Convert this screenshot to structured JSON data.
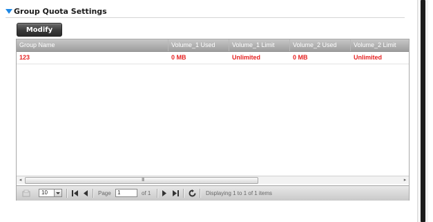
{
  "section": {
    "title": "Group Quota Settings"
  },
  "toolbar": {
    "modify_label": "Modify"
  },
  "grid": {
    "columns": [
      "Group Name",
      "Volume_1 Used",
      "Volume_1 Limit",
      "Volume_2 Used",
      "Volume_2 Limit"
    ],
    "rows": [
      {
        "group_name": "123",
        "v1_used": "0 MB",
        "v1_limit": "Unlimited",
        "v2_used": "0 MB",
        "v2_limit": "Unlimited"
      }
    ],
    "row_text_color": "#e52222"
  },
  "hscroll": {
    "left_arrow": "◂",
    "right_arrow": "▸",
    "grip": "III"
  },
  "pager": {
    "page_size": "10",
    "page_label": "Page",
    "page_value": "1",
    "of_label": "of 1",
    "status": "Displaying 1 to 1 of 1 items",
    "icons": [
      "first-page-icon",
      "prev-page-icon",
      "next-page-icon",
      "last-page-icon",
      "refresh-icon"
    ]
  },
  "colors": {
    "accent": "#1e88e5",
    "header_bg": "#9d9d9d",
    "button_bg": "#3a3a3a"
  }
}
